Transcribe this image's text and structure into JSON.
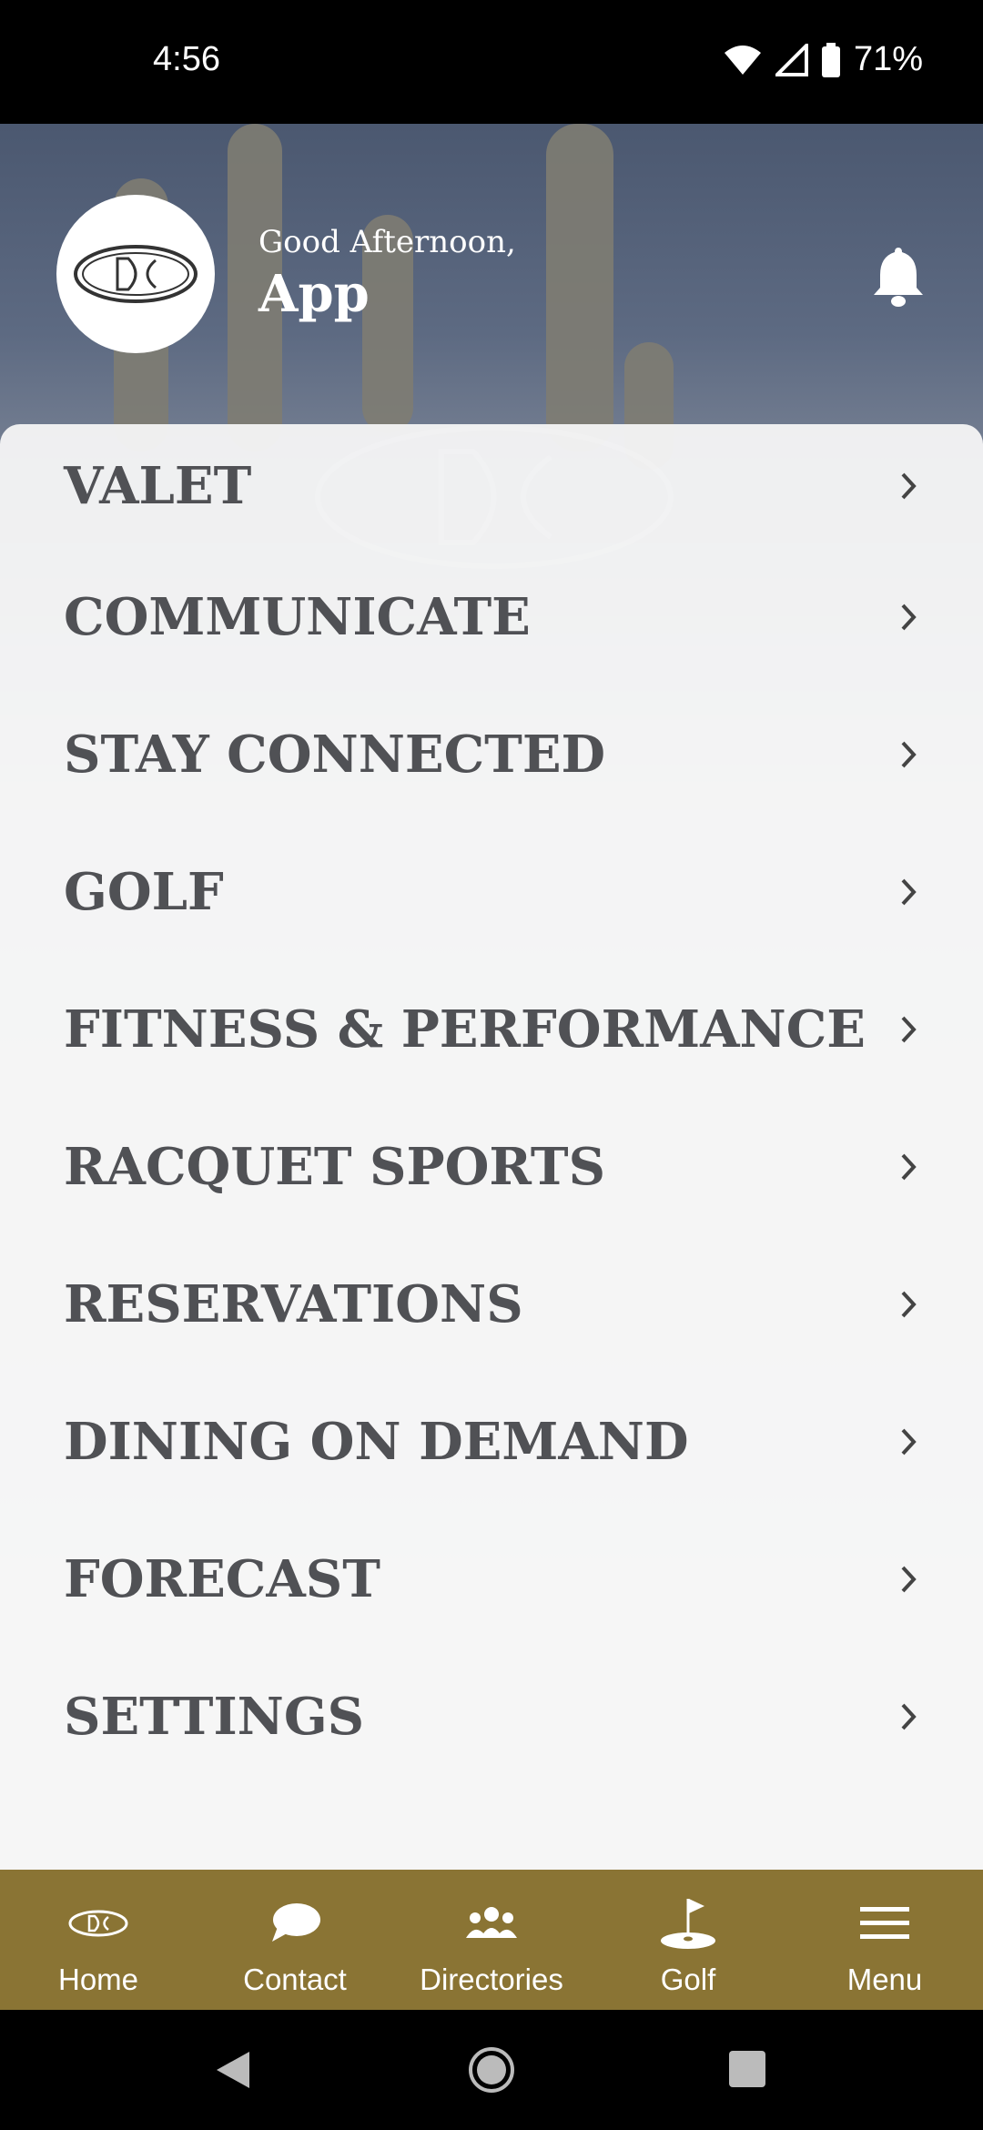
{
  "status_bar": {
    "time": "4:56",
    "battery": "71%"
  },
  "header": {
    "greeting": "Good Afternoon,",
    "username": "App"
  },
  "menu": {
    "items": [
      {
        "label": "VALET"
      },
      {
        "label": "COMMUNICATE"
      },
      {
        "label": "STAY CONNECTED"
      },
      {
        "label": "GOLF"
      },
      {
        "label": "FITNESS & PERFORMANCE"
      },
      {
        "label": "RACQUET SPORTS"
      },
      {
        "label": "RESERVATIONS"
      },
      {
        "label": "DINING ON DEMAND"
      },
      {
        "label": "FORECAST"
      },
      {
        "label": "SETTINGS"
      }
    ]
  },
  "bottom_nav": {
    "items": [
      {
        "label": "Home",
        "icon": "club-logo-icon"
      },
      {
        "label": "Contact",
        "icon": "chat-bubble-icon"
      },
      {
        "label": "Directories",
        "icon": "people-icon"
      },
      {
        "label": "Golf",
        "icon": "golf-flag-icon"
      },
      {
        "label": "Menu",
        "icon": "hamburger-menu-icon"
      }
    ]
  },
  "colors": {
    "accent": "#8a7434",
    "menu_text": "#505155"
  }
}
